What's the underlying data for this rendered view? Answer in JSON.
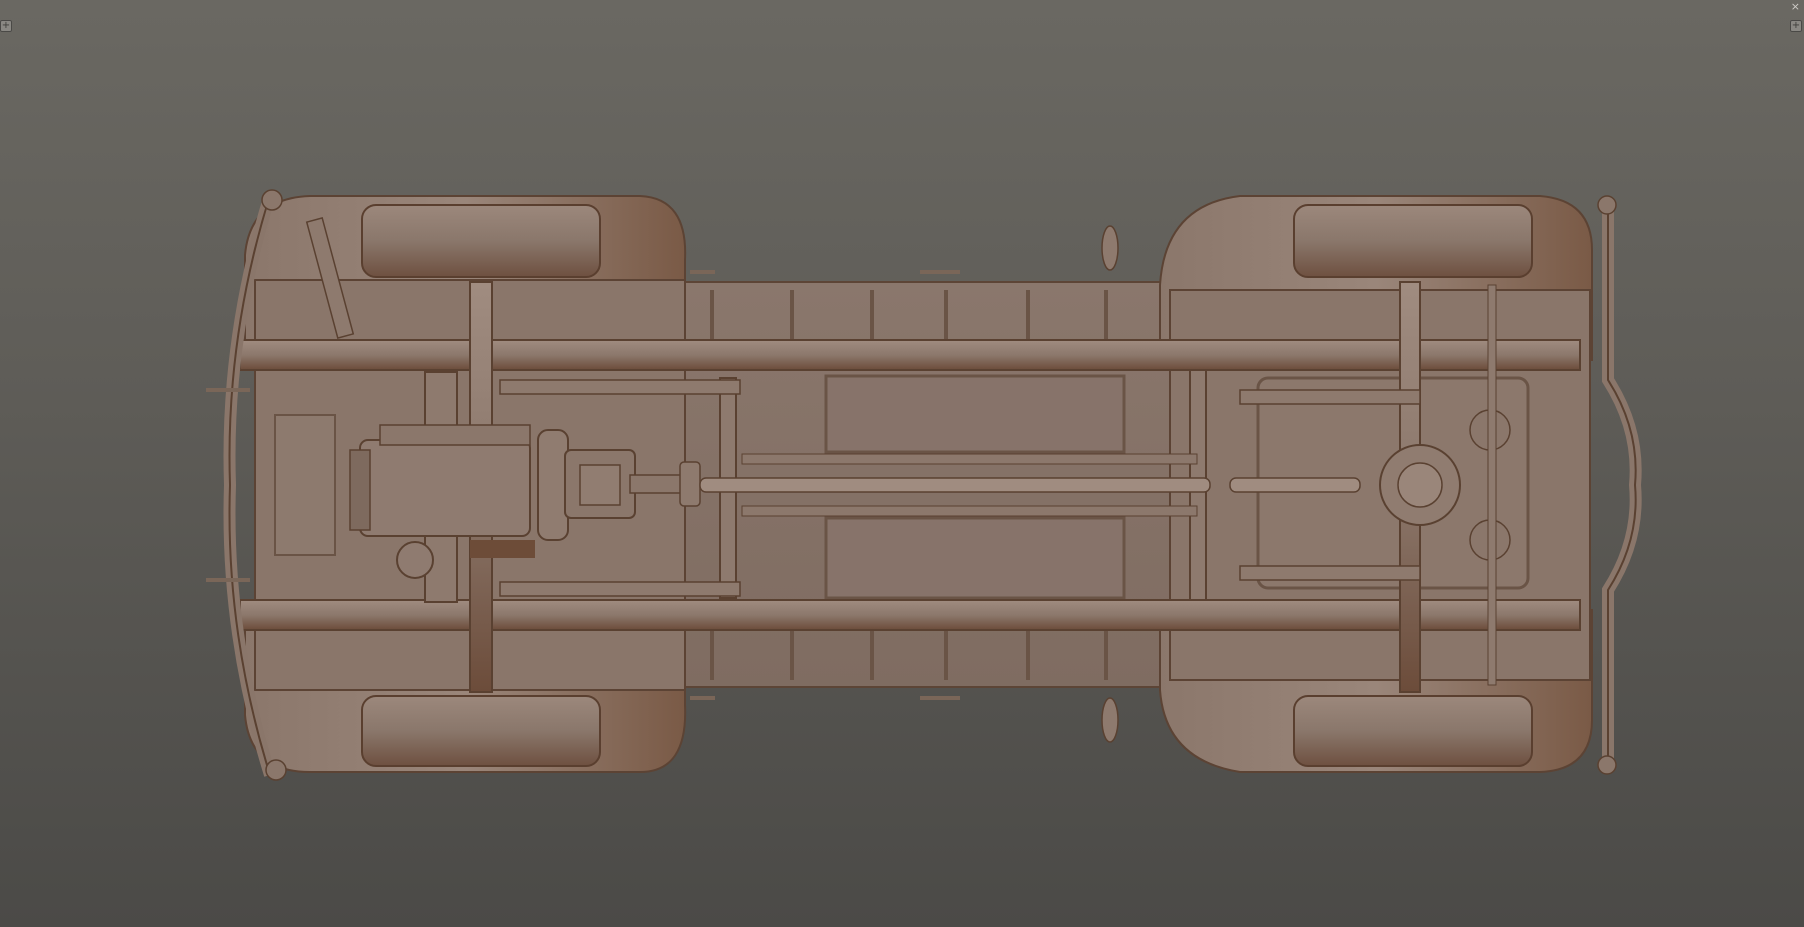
{
  "viewport": {
    "colors": {
      "bg_top": "#6a6862",
      "bg_bottom": "#4b4a47",
      "model_base": "#8e7b70",
      "model_shadow": "#6d4a36",
      "model_highlight": "#a89489"
    },
    "icons": {
      "top_left": "plus-icon",
      "top_right": "plus-icon",
      "corner": "close-icon"
    },
    "labels": {
      "top_left_glyph": "+",
      "top_right_glyph": "+",
      "corner_glyph": "×"
    }
  }
}
